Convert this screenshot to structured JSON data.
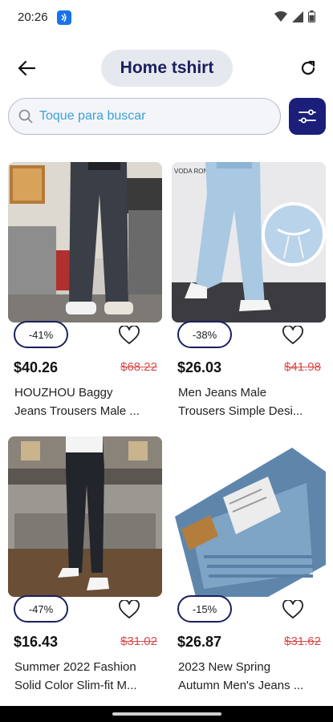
{
  "status_bar": {
    "time": "20:26"
  },
  "header": {
    "title": "Home tshirt"
  },
  "search": {
    "placeholder": "Toque para buscar"
  },
  "products": [
    {
      "discount": "-41%",
      "price": "$40.26",
      "old_price": "$68.22",
      "title_line1": "HOUZHOU Baggy",
      "title_line2": "Jeans Trousers Male ..."
    },
    {
      "discount": "-38%",
      "price": "$26.03",
      "old_price": "$41.98",
      "title_line1": "Men Jeans Male",
      "title_line2": "Trousers Simple Desi..."
    },
    {
      "discount": "-47%",
      "price": "$16.43",
      "old_price": "$31.02",
      "title_line1": "Summer 2022 Fashion",
      "title_line2": "Solid Color Slim-fit M..."
    },
    {
      "discount": "-15%",
      "price": "$26.87",
      "old_price": "$31.62",
      "title_line1": "2023 New Spring",
      "title_line2": "Autumn Men's Jeans ..."
    }
  ],
  "image_text": {
    "brand_tag": "VODA RONO"
  },
  "colors": {
    "brand_navy": "#1b1f5e",
    "filter_button": "#1b1f7a",
    "old_price": "#d94a4a",
    "placeholder": "#3aa2d8"
  },
  "icons": [
    "back-arrow-icon",
    "refresh-icon",
    "search-icon",
    "filter-sliders-icon",
    "heart-icon"
  ]
}
